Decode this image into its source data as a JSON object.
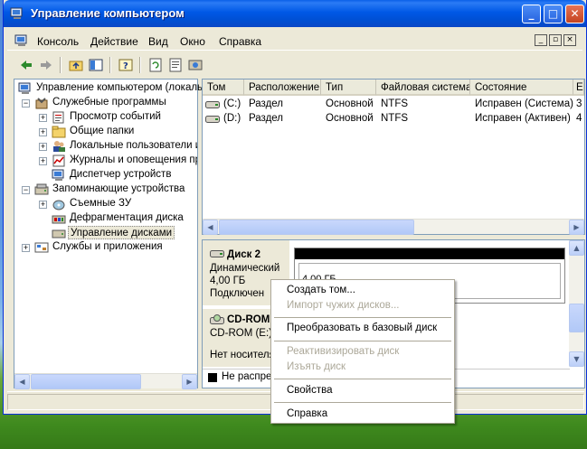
{
  "window": {
    "title": "Управление компьютером",
    "min_label": "_",
    "max_label": "□",
    "close_label": "✕"
  },
  "menu": {
    "items": [
      "Консоль",
      "Действие",
      "Вид",
      "Окно",
      "Справка"
    ]
  },
  "tree": {
    "root": "Управление компьютером (локаль",
    "items": [
      {
        "label": "Служебные программы"
      },
      {
        "label": "Просмотр событий"
      },
      {
        "label": "Общие папки"
      },
      {
        "label": "Локальные пользователи и"
      },
      {
        "label": "Журналы и оповещения пр"
      },
      {
        "label": "Диспетчер устройств"
      },
      {
        "label": "Запоминающие устройства"
      },
      {
        "label": "Съемные ЗУ"
      },
      {
        "label": "Дефрагментация диска"
      },
      {
        "label": "Управление дисками"
      },
      {
        "label": "Службы и приложения"
      }
    ]
  },
  "volumes": {
    "columns": [
      "Том",
      "Расположение",
      "Тип",
      "Файловая система",
      "Состояние",
      "Е"
    ],
    "rows": [
      {
        "tom": "(C:)",
        "location": "Раздел",
        "type": "Основной",
        "fs": "NTFS",
        "status": "Исправен (Система)",
        "e": "3"
      },
      {
        "tom": "(D:)",
        "location": "Раздел",
        "type": "Основной",
        "fs": "NTFS",
        "status": "Исправен (Активен)",
        "e": "4"
      }
    ]
  },
  "disks": {
    "disk2": {
      "name": "Диск 2",
      "kind": "Динамический",
      "size": "4,00 ГБ",
      "state": "Подключен",
      "partition_size": "4,00 ГБ"
    },
    "cdrom": {
      "name": "CD-ROM 0",
      "drive": "CD-ROM (E:)",
      "media": "Нет носителя"
    },
    "legend": "Не распределен"
  },
  "context_menu": {
    "items": [
      {
        "label": "Создать том...",
        "disabled": false
      },
      {
        "label": "Импорт чужих дисков...",
        "disabled": true
      },
      {
        "label": "Преобразовать в базовый диск",
        "disabled": false
      },
      {
        "label": "Реактивизировать диск",
        "disabled": true
      },
      {
        "label": "Изъять диск",
        "disabled": true
      },
      {
        "label": "Свойства",
        "disabled": false
      },
      {
        "label": "Справка",
        "disabled": false
      }
    ]
  },
  "colors": {
    "title_blue": "#0058e6",
    "close_red": "#c44421",
    "disabled_gray": "#aca899"
  }
}
